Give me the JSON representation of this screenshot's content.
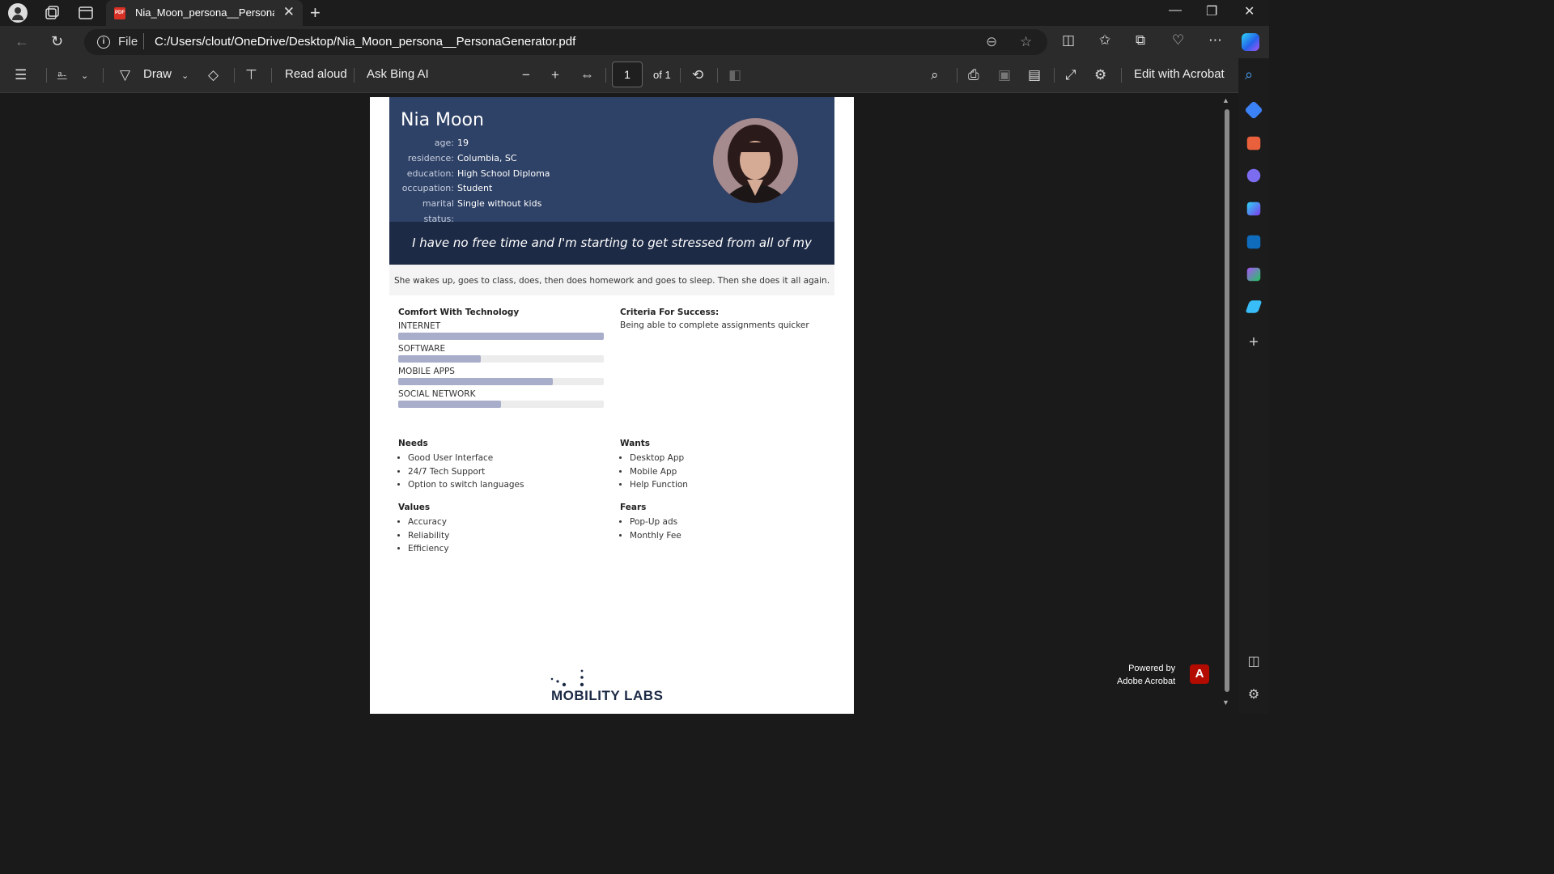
{
  "browser": {
    "tab_title": "Nia_Moon_persona__PersonaGenerator.pdf",
    "address_scheme": "File",
    "address_url": "C:/Users/clout/OneDrive/Desktop/Nia_Moon_persona__PersonaGenerator.pdf"
  },
  "pdf_toolbar": {
    "draw_label": "Draw",
    "read_aloud_label": "Read aloud",
    "ask_bing_label": "Ask Bing AI",
    "page_current": "1",
    "page_total": "of 1",
    "edit_acrobat_label": "Edit with Acrobat"
  },
  "powered_by": {
    "line1": "Powered by",
    "line2": "Adobe Acrobat"
  },
  "persona": {
    "name": "Nia Moon",
    "attributes": [
      {
        "label": "age:",
        "value": "19"
      },
      {
        "label": "residence:",
        "value": "Columbia, SC"
      },
      {
        "label": "education:",
        "value": "High School Diploma"
      },
      {
        "label": "occupation:",
        "value": "Student"
      },
      {
        "label": "marital status:",
        "value": "Single without kids"
      }
    ],
    "quote": "I have no free time and I'm starting to get stressed from all of my classes.",
    "day_in_life": "She wakes up, goes to class, does, then does homework and goes to sleep. Then she does it all again.",
    "tech_heading": "Comfort With Technology",
    "tech": [
      {
        "name": "INTERNET",
        "level": 1.0
      },
      {
        "name": "SOFTWARE",
        "level": 0.4
      },
      {
        "name": "MOBILE APPS",
        "level": 0.75
      },
      {
        "name": "SOCIAL NETWORK",
        "level": 0.5
      }
    ],
    "criteria_heading": "Criteria For Success:",
    "criteria_text": "Being able to complete assignments quicker",
    "needs_heading": "Needs",
    "needs": [
      "Good User Interface",
      "24/7 Tech Support",
      "Option to switch languages"
    ],
    "wants_heading": "Wants",
    "wants": [
      "Desktop App",
      "Mobile App",
      "Help Function"
    ],
    "values_heading": "Values",
    "values": [
      "Accuracy",
      "Reliability",
      "Efficiency"
    ],
    "fears_heading": "Fears",
    "fears": [
      "Pop-Up ads",
      "Monthly Fee"
    ],
    "logo_text": "MOBILITY LABS"
  },
  "colors": {
    "header_bg": "#2e4166",
    "quote_bg": "#1d2a45",
    "bar_fill": "#a8adc9",
    "bar_track": "#ececec"
  }
}
